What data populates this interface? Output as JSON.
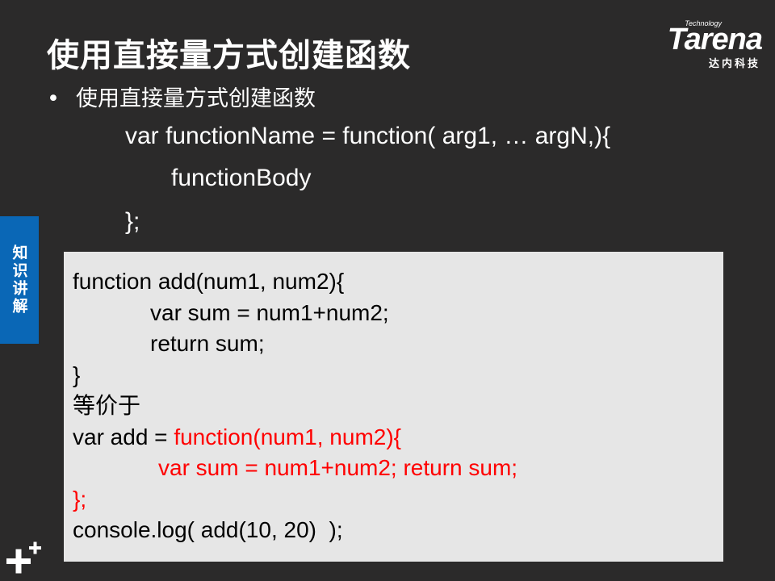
{
  "slide": {
    "title": "使用直接量方式创建函数",
    "bullet": "使用直接量方式创建函数",
    "bullet_marker": "•",
    "syntax_lines": [
      "var functionName = function( arg1, … argN,){",
      "functionBody",
      "};"
    ]
  },
  "logo": {
    "small_text": "Technology",
    "word": "Tarena",
    "chinese": "达内科技"
  },
  "side_tab": {
    "label": "知识讲解",
    "color": "#0a67b6"
  },
  "code": {
    "line1": "function add(num1, num2){",
    "line2": "var sum = num1+num2;",
    "line3": "return sum;",
    "line4": "}",
    "line5": "等价于",
    "line6_prefix": "var add = ",
    "line6_red": "function(num1, num2){",
    "line7_red": "var sum = num1+num2; return sum;",
    "line8_red": "};",
    "line9": "console.log( add(10, 20)  );",
    "highlight_color": "#ff0000"
  },
  "footer": {
    "icon": "plus-icon"
  }
}
